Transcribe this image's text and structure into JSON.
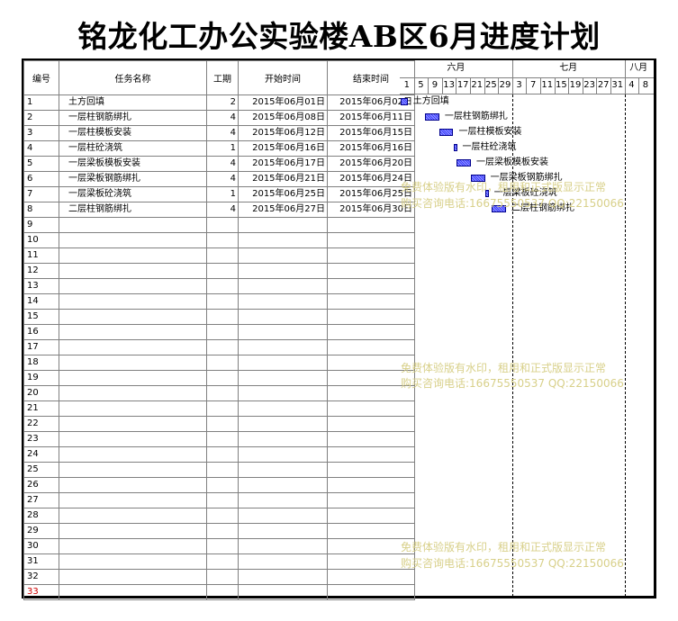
{
  "title": "铭龙化工办公实验楼AB区6月进度计划",
  "table": {
    "headers": {
      "no": "编号",
      "name": "任务名称",
      "duration": "工期",
      "start": "开始时间",
      "end": "结束时间"
    },
    "tasks": [
      {
        "no": "1",
        "name": "土方回填",
        "duration": "2",
        "start": "2015年06月01日",
        "end": "2015年06月02日"
      },
      {
        "no": "2",
        "name": "一层柱钢筋绑扎",
        "duration": "4",
        "start": "2015年06月08日",
        "end": "2015年06月11日"
      },
      {
        "no": "3",
        "name": "一层柱模板安装",
        "duration": "4",
        "start": "2015年06月12日",
        "end": "2015年06月15日"
      },
      {
        "no": "4",
        "name": "一层柱砼浇筑",
        "duration": "1",
        "start": "2015年06月16日",
        "end": "2015年06月16日"
      },
      {
        "no": "5",
        "name": "一层梁板模板安装",
        "duration": "4",
        "start": "2015年06月17日",
        "end": "2015年06月20日"
      },
      {
        "no": "6",
        "name": "一层梁板钢筋绑扎",
        "duration": "4",
        "start": "2015年06月21日",
        "end": "2015年06月24日"
      },
      {
        "no": "7",
        "name": "一层梁板砼浇筑",
        "duration": "1",
        "start": "2015年06月25日",
        "end": "2015年06月25日"
      },
      {
        "no": "8",
        "name": "二层柱钢筋绑扎",
        "duration": "4",
        "start": "2015年06月27日",
        "end": "2015年06月30日"
      }
    ],
    "empty_rows": [
      "9",
      "10",
      "11",
      "12",
      "13",
      "14",
      "15",
      "16",
      "17",
      "18",
      "19",
      "20",
      "21",
      "22",
      "23",
      "24",
      "25",
      "26",
      "27",
      "28",
      "29",
      "30",
      "31",
      "32"
    ],
    "last_row": "33"
  },
  "gantt": {
    "months": [
      "六月",
      "七月",
      "八月"
    ],
    "days": [
      "1",
      "5",
      "9",
      "13",
      "17",
      "21",
      "25",
      "29",
      "3",
      "7",
      "11",
      "15",
      "19",
      "23",
      "27",
      "31",
      "4",
      "8"
    ],
    "bar_color": "#3a3aff"
  },
  "watermark": {
    "line1": "免费体验版有水印，租用和正式版显示正常",
    "line2": "购买咨询电话:16675550537 QQ:22150066"
  }
}
